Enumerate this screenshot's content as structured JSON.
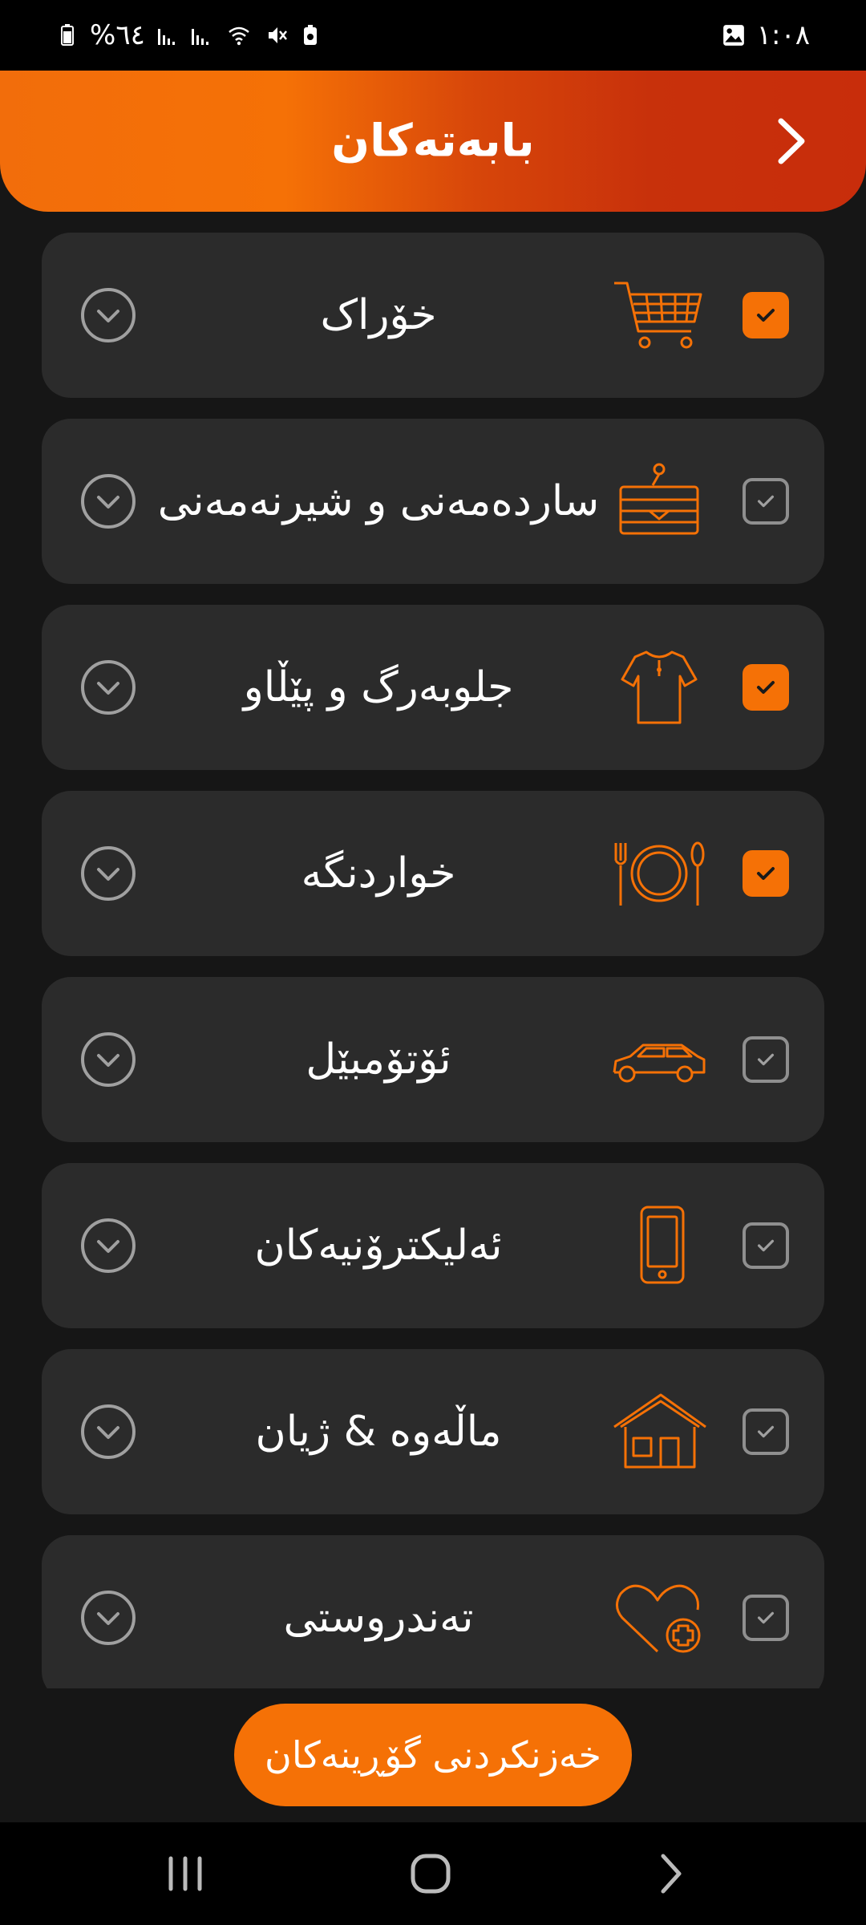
{
  "status_bar": {
    "battery_text": "%٦٤",
    "time": "١:٠٨"
  },
  "header": {
    "title": "بابەتەکان"
  },
  "categories": [
    {
      "label": "خۆراک",
      "checked": true,
      "icon": "shopping-cart-icon"
    },
    {
      "label": "ساردەمەنی و شیرنەمەنی",
      "checked": false,
      "icon": "cake-icon"
    },
    {
      "label": "جلوبەرگ و پێڵاو",
      "checked": true,
      "icon": "shirt-icon"
    },
    {
      "label": "خواردنگە",
      "checked": true,
      "icon": "plate-cutlery-icon"
    },
    {
      "label": "ئۆتۆمبێل",
      "checked": false,
      "icon": "car-icon"
    },
    {
      "label": "ئەلیکترۆنیەکان",
      "checked": false,
      "icon": "smartphone-icon"
    },
    {
      "label": "ماڵەوە & ژیان",
      "checked": false,
      "icon": "house-icon"
    },
    {
      "label": "تەندروستی",
      "checked": false,
      "icon": "heart-plus-icon"
    }
  ],
  "save_button": {
    "label": "خەزنکردنی گۆڕینەکان"
  },
  "colors": {
    "accent": "#f57106",
    "card_bg": "#2b2b2b",
    "screen_bg": "#161616"
  }
}
